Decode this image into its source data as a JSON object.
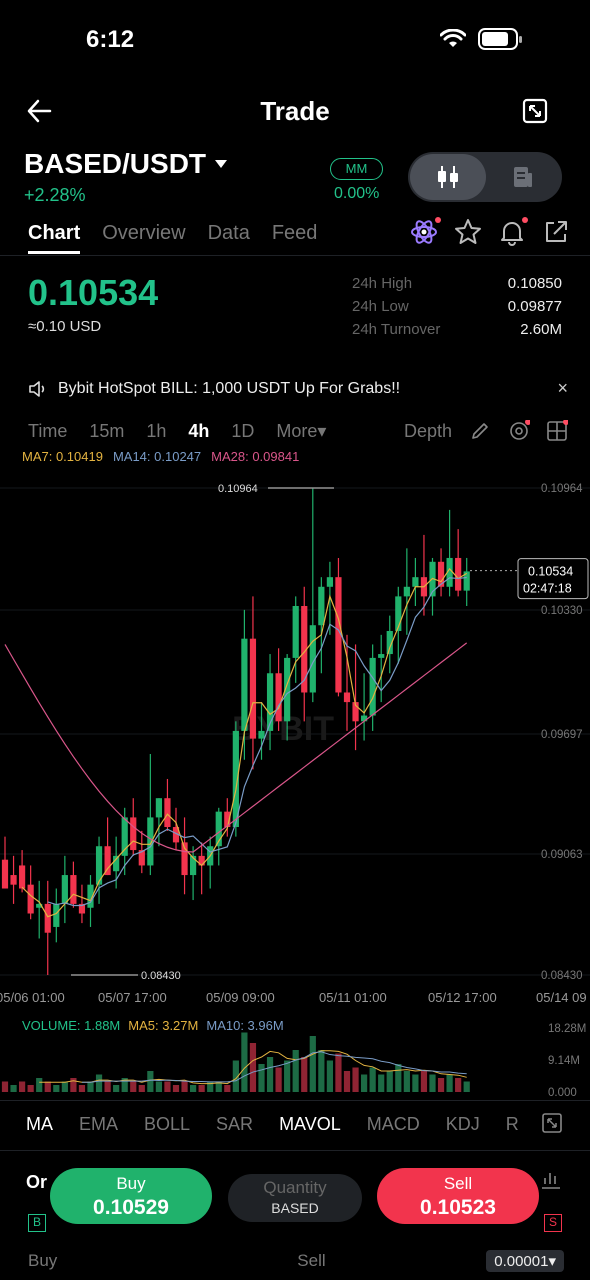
{
  "status": {
    "time": "6:12"
  },
  "nav": {
    "title": "Trade"
  },
  "pair": {
    "symbol": "BASED/USDT",
    "change": "+2.28%",
    "mm_label": "MM",
    "mm_value": "0.00%"
  },
  "tabs": [
    "Chart",
    "Overview",
    "Data",
    "Feed"
  ],
  "price": {
    "last": "0.10534",
    "usd": "≈0.10 USD",
    "stats": [
      {
        "label": "24h High",
        "value": "0.10850"
      },
      {
        "label": "24h Low",
        "value": "0.09877"
      },
      {
        "label": "24h Turnover",
        "value": "2.60M"
      }
    ]
  },
  "banner": {
    "text": "Bybit HotSpot BILL: 1,000 USDT Up For Grabs!!",
    "close": "×"
  },
  "intervals": {
    "items": [
      "Time",
      "15m",
      "1h",
      "4h",
      "1D",
      "More▾"
    ],
    "active": "4h",
    "depth": "Depth"
  },
  "ma_legend": [
    {
      "text": "MA7: 0.10419",
      "color": "#e3b341"
    },
    {
      "text": "MA14: 0.10247",
      "color": "#7a9cc7"
    },
    {
      "text": "MA28: 0.09841",
      "color": "#d9568a"
    }
  ],
  "chart_data": {
    "type": "candlestick",
    "y_ticks": [
      "0.10964",
      "0.10330",
      "0.09697",
      "0.09063",
      "0.08430"
    ],
    "x_ticks": [
      "05/06 01:00",
      "05/07 17:00",
      "05/09 09:00",
      "05/11 01:00",
      "05/12 17:00",
      "05/14 09"
    ],
    "high_label": "0.10964",
    "low_label": "0.08430",
    "current_price": "0.10534",
    "countdown": "02:47:18",
    "ylim": [
      0.0843,
      0.10964
    ],
    "colors": {
      "up": "#20b26c",
      "down": "#f2344d",
      "ma7": "#e3b341",
      "ma14": "#7a9cc7",
      "ma28": "#d9568a"
    }
  },
  "volume": {
    "legend": [
      "VOLUME: 1.88M",
      "MA5: 3.27M",
      "MA10: 3.96M"
    ],
    "y_ticks": [
      "18.28M",
      "9.14M",
      "0.000"
    ]
  },
  "indicators": {
    "items": [
      "MA",
      "EMA",
      "BOLL",
      "SAR",
      "MAVOL",
      "MACD",
      "KDJ",
      "R"
    ],
    "active": [
      "MA",
      "MAVOL"
    ]
  },
  "order": {
    "buy_label": "Buy",
    "buy_price": "0.10529",
    "qty_label": "Quantity",
    "qty_unit": "BASED",
    "sell_label": "Sell",
    "sell_price": "0.10523",
    "bottom_buy": "Buy",
    "bottom_sell": "Sell",
    "precision": "0.00001▾"
  }
}
